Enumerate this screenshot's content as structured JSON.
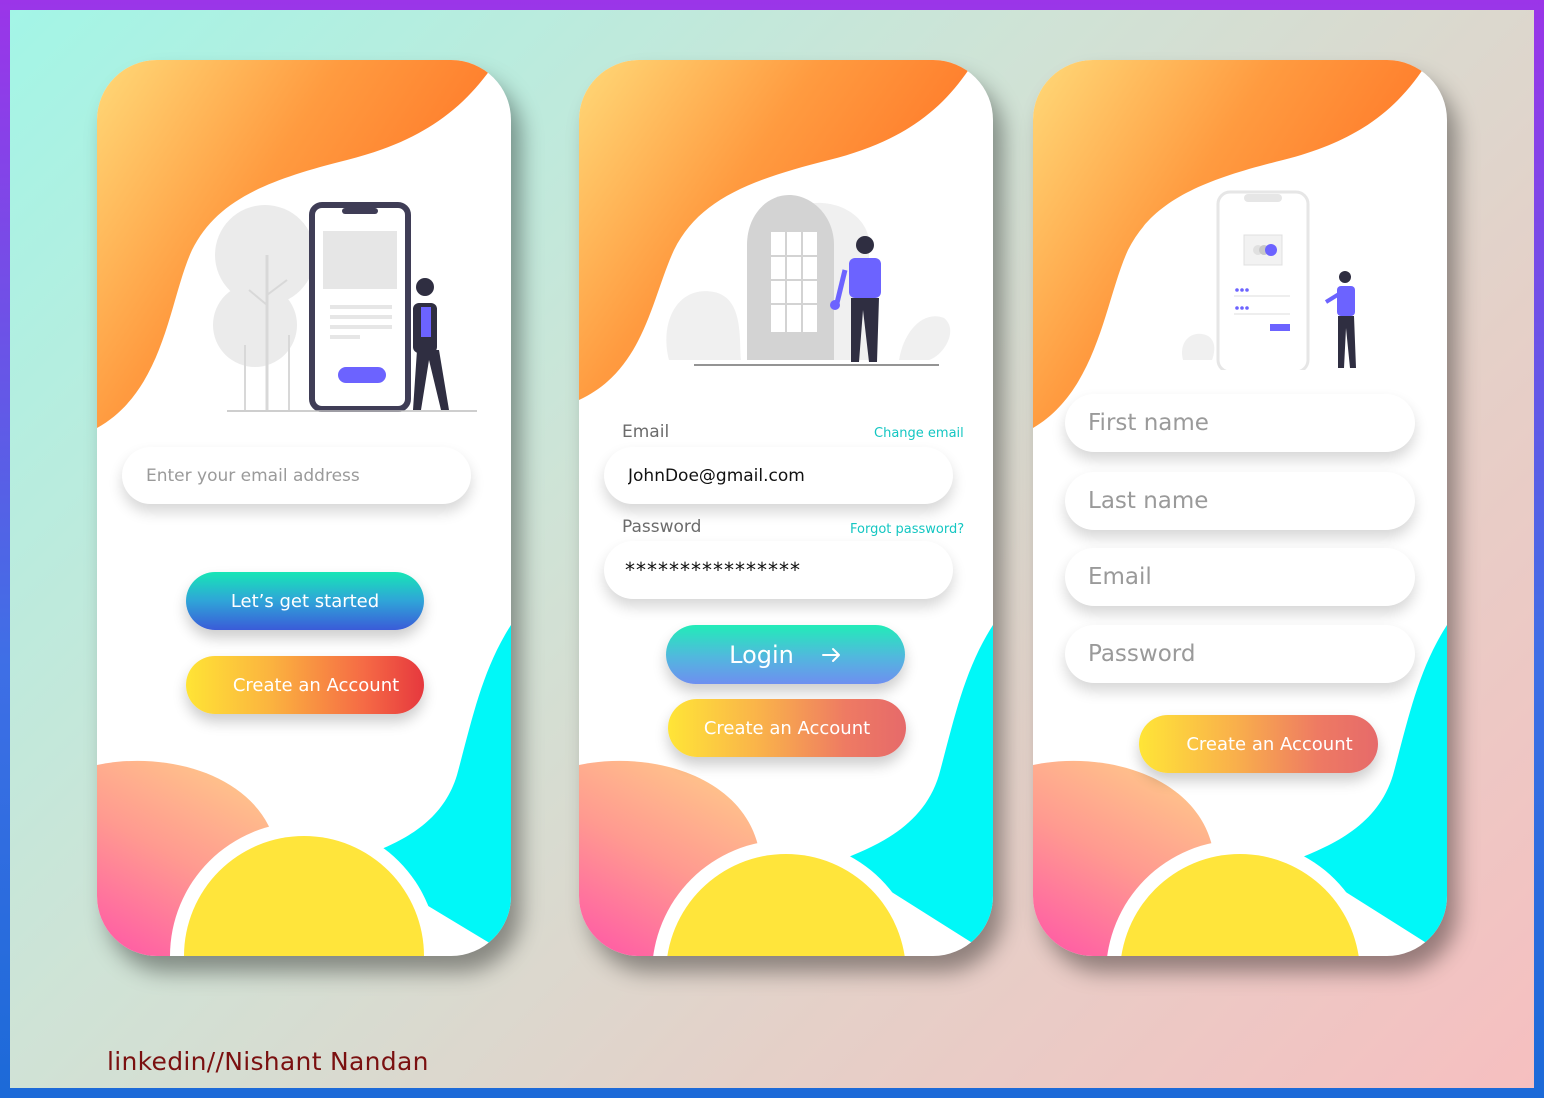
{
  "screen1": {
    "email_placeholder": "Enter your email address",
    "start_button": "Let’s get started",
    "create_button": "Create an Account"
  },
  "screen2": {
    "email_label": "Email",
    "change_email_link": "Change email",
    "email_value": "JohnDoe@gmail.com",
    "password_label": "Password",
    "forgot_password_link": "Forgot password?",
    "password_value": "****************",
    "login_button": "Login",
    "login_icon": "arrow-right-icon",
    "create_button": "Create an Account"
  },
  "screen3": {
    "first_name_placeholder": "First name",
    "last_name_placeholder": "Last name",
    "email_placeholder": "Email",
    "password_placeholder": "Password",
    "create_button": "Create an Account"
  },
  "credit": "linkedin//Nishant Nandan",
  "colors": {
    "accent_purple": "#6c63ff",
    "link_teal": "#14c6c2",
    "cyan_wave": "#00f8f8",
    "yellow_circle": "#ffe53b",
    "credit_text": "#7a1010"
  }
}
